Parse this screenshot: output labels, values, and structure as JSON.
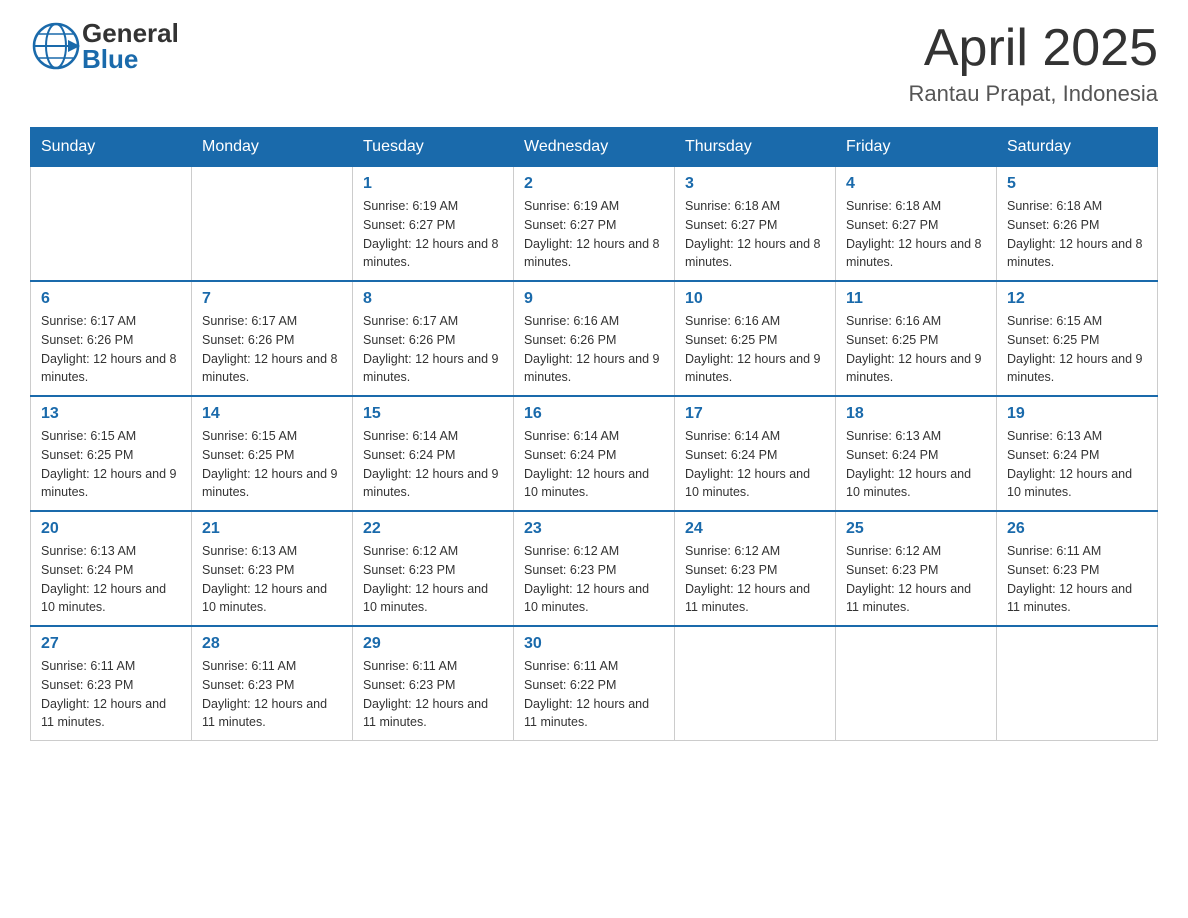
{
  "header": {
    "logo_general": "General",
    "logo_blue": "Blue",
    "month_title": "April 2025",
    "location": "Rantau Prapat, Indonesia"
  },
  "days_of_week": [
    "Sunday",
    "Monday",
    "Tuesday",
    "Wednesday",
    "Thursday",
    "Friday",
    "Saturday"
  ],
  "weeks": [
    [
      {
        "day": "",
        "sunrise": "",
        "sunset": "",
        "daylight": ""
      },
      {
        "day": "",
        "sunrise": "",
        "sunset": "",
        "daylight": ""
      },
      {
        "day": "1",
        "sunrise": "Sunrise: 6:19 AM",
        "sunset": "Sunset: 6:27 PM",
        "daylight": "Daylight: 12 hours and 8 minutes."
      },
      {
        "day": "2",
        "sunrise": "Sunrise: 6:19 AM",
        "sunset": "Sunset: 6:27 PM",
        "daylight": "Daylight: 12 hours and 8 minutes."
      },
      {
        "day": "3",
        "sunrise": "Sunrise: 6:18 AM",
        "sunset": "Sunset: 6:27 PM",
        "daylight": "Daylight: 12 hours and 8 minutes."
      },
      {
        "day": "4",
        "sunrise": "Sunrise: 6:18 AM",
        "sunset": "Sunset: 6:27 PM",
        "daylight": "Daylight: 12 hours and 8 minutes."
      },
      {
        "day": "5",
        "sunrise": "Sunrise: 6:18 AM",
        "sunset": "Sunset: 6:26 PM",
        "daylight": "Daylight: 12 hours and 8 minutes."
      }
    ],
    [
      {
        "day": "6",
        "sunrise": "Sunrise: 6:17 AM",
        "sunset": "Sunset: 6:26 PM",
        "daylight": "Daylight: 12 hours and 8 minutes."
      },
      {
        "day": "7",
        "sunrise": "Sunrise: 6:17 AM",
        "sunset": "Sunset: 6:26 PM",
        "daylight": "Daylight: 12 hours and 8 minutes."
      },
      {
        "day": "8",
        "sunrise": "Sunrise: 6:17 AM",
        "sunset": "Sunset: 6:26 PM",
        "daylight": "Daylight: 12 hours and 9 minutes."
      },
      {
        "day": "9",
        "sunrise": "Sunrise: 6:16 AM",
        "sunset": "Sunset: 6:26 PM",
        "daylight": "Daylight: 12 hours and 9 minutes."
      },
      {
        "day": "10",
        "sunrise": "Sunrise: 6:16 AM",
        "sunset": "Sunset: 6:25 PM",
        "daylight": "Daylight: 12 hours and 9 minutes."
      },
      {
        "day": "11",
        "sunrise": "Sunrise: 6:16 AM",
        "sunset": "Sunset: 6:25 PM",
        "daylight": "Daylight: 12 hours and 9 minutes."
      },
      {
        "day": "12",
        "sunrise": "Sunrise: 6:15 AM",
        "sunset": "Sunset: 6:25 PM",
        "daylight": "Daylight: 12 hours and 9 minutes."
      }
    ],
    [
      {
        "day": "13",
        "sunrise": "Sunrise: 6:15 AM",
        "sunset": "Sunset: 6:25 PM",
        "daylight": "Daylight: 12 hours and 9 minutes."
      },
      {
        "day": "14",
        "sunrise": "Sunrise: 6:15 AM",
        "sunset": "Sunset: 6:25 PM",
        "daylight": "Daylight: 12 hours and 9 minutes."
      },
      {
        "day": "15",
        "sunrise": "Sunrise: 6:14 AM",
        "sunset": "Sunset: 6:24 PM",
        "daylight": "Daylight: 12 hours and 9 minutes."
      },
      {
        "day": "16",
        "sunrise": "Sunrise: 6:14 AM",
        "sunset": "Sunset: 6:24 PM",
        "daylight": "Daylight: 12 hours and 10 minutes."
      },
      {
        "day": "17",
        "sunrise": "Sunrise: 6:14 AM",
        "sunset": "Sunset: 6:24 PM",
        "daylight": "Daylight: 12 hours and 10 minutes."
      },
      {
        "day": "18",
        "sunrise": "Sunrise: 6:13 AM",
        "sunset": "Sunset: 6:24 PM",
        "daylight": "Daylight: 12 hours and 10 minutes."
      },
      {
        "day": "19",
        "sunrise": "Sunrise: 6:13 AM",
        "sunset": "Sunset: 6:24 PM",
        "daylight": "Daylight: 12 hours and 10 minutes."
      }
    ],
    [
      {
        "day": "20",
        "sunrise": "Sunrise: 6:13 AM",
        "sunset": "Sunset: 6:24 PM",
        "daylight": "Daylight: 12 hours and 10 minutes."
      },
      {
        "day": "21",
        "sunrise": "Sunrise: 6:13 AM",
        "sunset": "Sunset: 6:23 PM",
        "daylight": "Daylight: 12 hours and 10 minutes."
      },
      {
        "day": "22",
        "sunrise": "Sunrise: 6:12 AM",
        "sunset": "Sunset: 6:23 PM",
        "daylight": "Daylight: 12 hours and 10 minutes."
      },
      {
        "day": "23",
        "sunrise": "Sunrise: 6:12 AM",
        "sunset": "Sunset: 6:23 PM",
        "daylight": "Daylight: 12 hours and 10 minutes."
      },
      {
        "day": "24",
        "sunrise": "Sunrise: 6:12 AM",
        "sunset": "Sunset: 6:23 PM",
        "daylight": "Daylight: 12 hours and 11 minutes."
      },
      {
        "day": "25",
        "sunrise": "Sunrise: 6:12 AM",
        "sunset": "Sunset: 6:23 PM",
        "daylight": "Daylight: 12 hours and 11 minutes."
      },
      {
        "day": "26",
        "sunrise": "Sunrise: 6:11 AM",
        "sunset": "Sunset: 6:23 PM",
        "daylight": "Daylight: 12 hours and 11 minutes."
      }
    ],
    [
      {
        "day": "27",
        "sunrise": "Sunrise: 6:11 AM",
        "sunset": "Sunset: 6:23 PM",
        "daylight": "Daylight: 12 hours and 11 minutes."
      },
      {
        "day": "28",
        "sunrise": "Sunrise: 6:11 AM",
        "sunset": "Sunset: 6:23 PM",
        "daylight": "Daylight: 12 hours and 11 minutes."
      },
      {
        "day": "29",
        "sunrise": "Sunrise: 6:11 AM",
        "sunset": "Sunset: 6:23 PM",
        "daylight": "Daylight: 12 hours and 11 minutes."
      },
      {
        "day": "30",
        "sunrise": "Sunrise: 6:11 AM",
        "sunset": "Sunset: 6:22 PM",
        "daylight": "Daylight: 12 hours and 11 minutes."
      },
      {
        "day": "",
        "sunrise": "",
        "sunset": "",
        "daylight": ""
      },
      {
        "day": "",
        "sunrise": "",
        "sunset": "",
        "daylight": ""
      },
      {
        "day": "",
        "sunrise": "",
        "sunset": "",
        "daylight": ""
      }
    ]
  ]
}
